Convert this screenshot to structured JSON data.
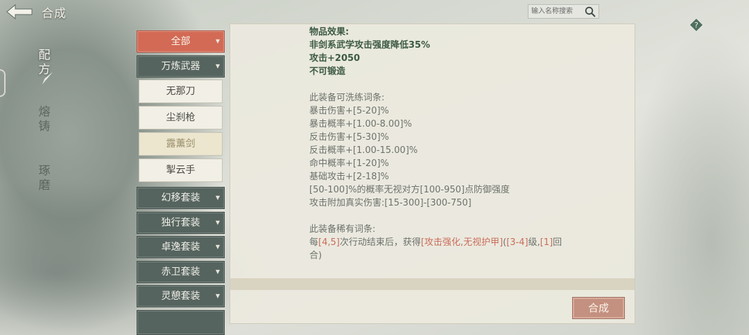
{
  "header": {
    "title": "合成",
    "search_placeholder": "输入名称搜索"
  },
  "side_tabs": [
    "配方",
    "熔铸",
    "琢磨"
  ],
  "categories": {
    "all": "全部",
    "wanlian": "万炼武器",
    "items": [
      "无那刀",
      "尘刹枪",
      "露薰剑",
      "掣云手"
    ],
    "groups": [
      "幻移套装",
      "独行套装",
      "卓逸套装",
      "赤卫套装",
      "灵憩套装"
    ]
  },
  "detail": {
    "effect_title": "物品效果:",
    "effects": [
      "非剑系武学攻击强度降低35%",
      "攻击+2050",
      "不可锻造"
    ],
    "reforge_title": "此装备可洗练词条:",
    "reforge": [
      "暴击伤害+[5-20]%",
      "暴击概率+[1.00-8.00]%",
      "反击伤害+[5-30]%",
      "反击概率+[1.00-15.00]%",
      "命中概率+[1-20]%",
      "基础攻击+[2-18]%",
      "[50-100]%的概率无视对方[100-950]点防御强度",
      "攻击附加真实伤害:[15-300]-[300-750]"
    ],
    "rare_title": "此装备稀有词条:",
    "rare_parts": [
      "每",
      "[4,5]",
      "次行动结束后，获得",
      "[攻击强化,无视护甲]",
      "(",
      "[3-4]",
      "级,",
      "[1]",
      "回"
    ],
    "rare_line2": "合)"
  },
  "actions": {
    "synthesize": "合成"
  },
  "colors": {
    "selected": "#d26a55",
    "group": "#56645f",
    "text_dark": "#3c5a45",
    "highlight": "#c96d5a"
  }
}
